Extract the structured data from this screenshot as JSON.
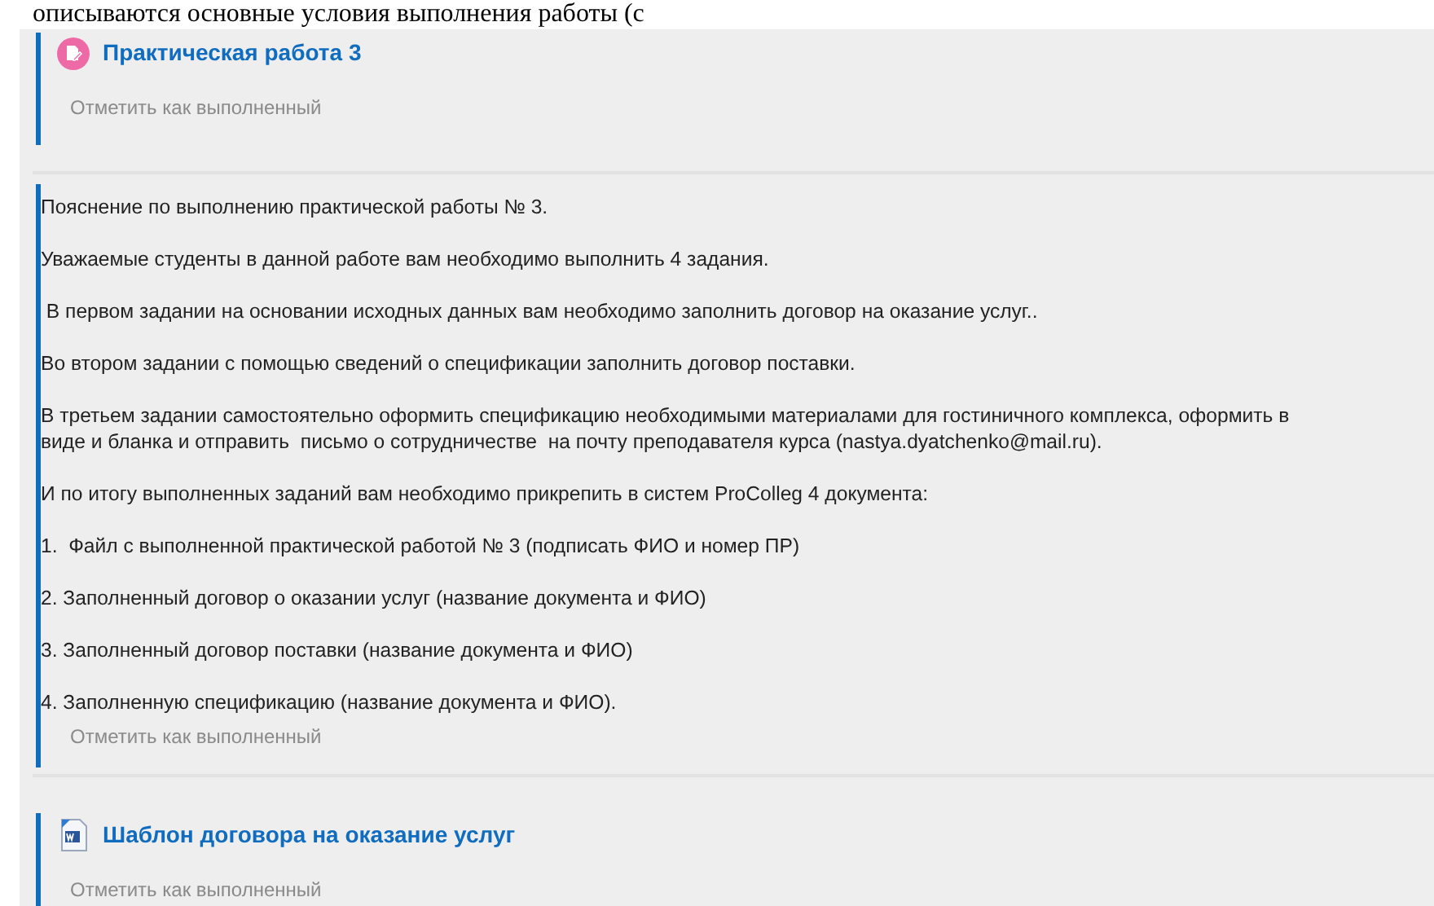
{
  "header_text": "описываются основные условия выполнения работы (с",
  "sections": [
    {
      "kind": "assignment",
      "title": "Практическая работа 3",
      "mark_done": "Отметить как выполненный"
    },
    {
      "kind": "text",
      "paragraphs": [
        "Пояснение по выполнению практической работы № 3.",
        "Уважаемые студенты в данной работе вам необходимо выполнить 4 задания.",
        " В первом задании на основании исходных данных вам необходимо заполнить договор на оказание услуг..",
        "Во втором задании с помощью сведений о спецификации заполнить договор поставки.",
        "В третьем задании самостоятельно оформить спецификацию необходимыми материалами для гостиничного комплекса, оформить в виде и бланка и отправить  письмо о сотрудничестве  на почту преподавателя курса (nastya.dyatchenko@mail.ru).",
        "И по итогу выполненных заданий вам необходимо прикрепить в систем ProColleg 4 документа:",
        "1.  Файл с выполненной практической работой № 3 (подписать ФИО и номер ПР)",
        "2. Заполненный договор о оказании услуг (название документа и ФИО)",
        "3. Заполненный договор поставки (название документа и ФИО)",
        "4. Заполненную спецификацию (название документа и ФИО)."
      ],
      "mark_done": "Отметить как выполненный"
    },
    {
      "kind": "file",
      "title": "Шаблон договора на оказание услуг",
      "mark_done": "Отметить как выполненный"
    }
  ]
}
